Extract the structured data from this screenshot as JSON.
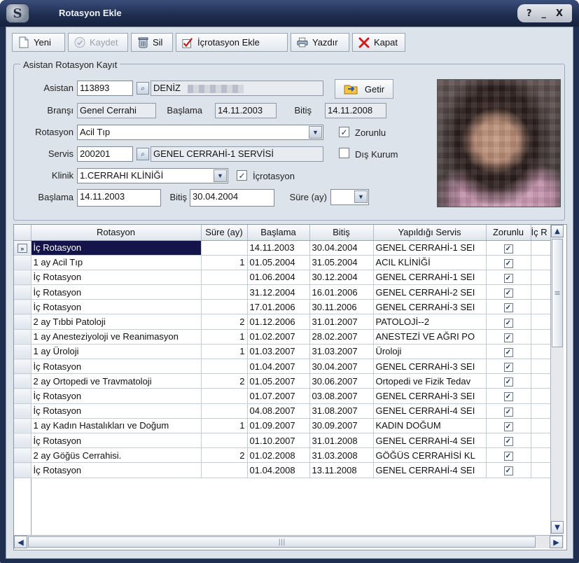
{
  "window": {
    "title": "Rotasyon Ekle",
    "controls": {
      "help": "?",
      "minimize": "_",
      "close": "X"
    }
  },
  "toolbar": {
    "new_label": "Yeni",
    "save_label": "Kaydet",
    "delete_label": "Sil",
    "add_internal_label": "İçrotasyon Ekle",
    "print_label": "Yazdır",
    "close_label": "Kapat"
  },
  "form": {
    "legend": "Asistan Rotasyon Kayıt",
    "assistant_label": "Asistan",
    "assistant_id": "113893",
    "assistant_name": "DENİZ",
    "fetch_label": "Getir",
    "branch_label": "Branşı",
    "branch_value": "Genel Cerrahi",
    "start_label_top": "Başlama",
    "start_value_top": "14.11.2003",
    "end_label_top": "Bitiş",
    "end_value_top": "14.11.2008",
    "rotation_label": "Rotasyon",
    "rotation_value": "Acil Tıp",
    "mandatory_label": "Zorunlu",
    "mandatory_checked": true,
    "service_label": "Servis",
    "service_code": "200201",
    "service_name": "GENEL CERRAHİ-1 SERVİSİ",
    "external_label": "Dış Kurum",
    "external_checked": false,
    "clinic_label": "Klinik",
    "clinic_value": "1.CERRAHI KLİNİĞİ",
    "internal_rotation_label": "İçrotasyon",
    "internal_rotation_checked": true,
    "start_label": "Başlama",
    "start_value": "14.11.2003",
    "end_label": "Bitiş",
    "end_value": "30.04.2004",
    "duration_label": "Süre (ay)",
    "duration_value": ""
  },
  "table": {
    "columns": [
      "Rotasyon",
      "Süre (ay)",
      "Başlama",
      "Bitiş",
      "Yapıldığı Servis",
      "Zorunlu",
      "İç R"
    ],
    "rows": [
      {
        "rotasyon": "İç Rotasyon",
        "sure": "",
        "baslama": "14.11.2003",
        "bitis": "30.04.2004",
        "servis": "GENEL CERRAHİ-1 SEI",
        "zorunlu": true,
        "selected": true
      },
      {
        "rotasyon": "1 ay Acil Tıp",
        "sure": "1",
        "baslama": "01.05.2004",
        "bitis": "31.05.2004",
        "servis": "ACIL KLİNİĞİ",
        "zorunlu": true
      },
      {
        "rotasyon": "İç Rotasyon",
        "sure": "",
        "baslama": "01.06.2004",
        "bitis": "30.12.2004",
        "servis": "GENEL CERRAHİ-1 SEI",
        "zorunlu": true
      },
      {
        "rotasyon": "İç Rotasyon",
        "sure": "",
        "baslama": "31.12.2004",
        "bitis": "16.01.2006",
        "servis": "GENEL CERRAHİ-2 SEI",
        "zorunlu": true
      },
      {
        "rotasyon": "İç Rotasyon",
        "sure": "",
        "baslama": "17.01.2006",
        "bitis": "30.11.2006",
        "servis": "GENEL CERRAHİ-3 SEI",
        "zorunlu": true
      },
      {
        "rotasyon": "2 ay Tıbbi Patoloji",
        "sure": "2",
        "baslama": "01.12.2006",
        "bitis": "31.01.2007",
        "servis": "PATOLOJİ--2",
        "zorunlu": true
      },
      {
        "rotasyon": "1 ay Anesteziyoloji ve Reanimasyon",
        "sure": "1",
        "baslama": "01.02.2007",
        "bitis": "28.02.2007",
        "servis": "ANESTEZİ VE AĞRI PO",
        "zorunlu": true
      },
      {
        "rotasyon": "1 ay Üroloji",
        "sure": "1",
        "baslama": "01.03.2007",
        "bitis": "31.03.2007",
        "servis": "Üroloji",
        "zorunlu": true
      },
      {
        "rotasyon": "İç Rotasyon",
        "sure": "",
        "baslama": "01.04.2007",
        "bitis": "30.04.2007",
        "servis": "GENEL CERRAHİ-3 SEI",
        "zorunlu": true
      },
      {
        "rotasyon": "2 ay Ortopedi ve Travmatoloji",
        "sure": "2",
        "baslama": "01.05.2007",
        "bitis": "30.06.2007",
        "servis": "Ortopedi ve Fizik Tedav",
        "zorunlu": true
      },
      {
        "rotasyon": "İç Rotasyon",
        "sure": "",
        "baslama": "01.07.2007",
        "bitis": "03.08.2007",
        "servis": "GENEL CERRAHİ-3 SEI",
        "zorunlu": true
      },
      {
        "rotasyon": "İç Rotasyon",
        "sure": "",
        "baslama": "04.08.2007",
        "bitis": "31.08.2007",
        "servis": "GENEL CERRAHİ-4 SEI",
        "zorunlu": true
      },
      {
        "rotasyon": "1 ay Kadın Hastalıkları ve Doğum",
        "sure": "1",
        "baslama": "01.09.2007",
        "bitis": "30.09.2007",
        "servis": "KADIN DOĞUM",
        "zorunlu": true
      },
      {
        "rotasyon": "İç Rotasyon",
        "sure": "",
        "baslama": "01.10.2007",
        "bitis": "31.01.2008",
        "servis": "GENEL CERRAHİ-4 SEI",
        "zorunlu": true
      },
      {
        "rotasyon": "2 ay Göğüs Cerrahisi.",
        "sure": "2",
        "baslama": "01.02.2008",
        "bitis": "31.03.2008",
        "servis": "GÖĞÜS CERRAHİSİ KL",
        "zorunlu": true
      },
      {
        "rotasyon": "İç Rotasyon",
        "sure": "",
        "baslama": "01.04.2008",
        "bitis": "13.11.2008",
        "servis": "GENEL CERRAHİ-4 SEI",
        "zorunlu": true
      }
    ]
  },
  "colors": {
    "selection": "#14134a",
    "title_bar": "#1e2c4e",
    "client_bg": "#dde3ea",
    "check_accent": "#1e3a6e"
  },
  "icons": {
    "app": "app-logo-icon",
    "new": "document-icon",
    "save": "check-circle-icon",
    "delete": "trash-icon",
    "add_internal": "checkmark-icon",
    "print": "printer-icon",
    "close": "red-x-icon",
    "fetch": "folder-arrow-icon",
    "lookup": "lookup-icon"
  }
}
